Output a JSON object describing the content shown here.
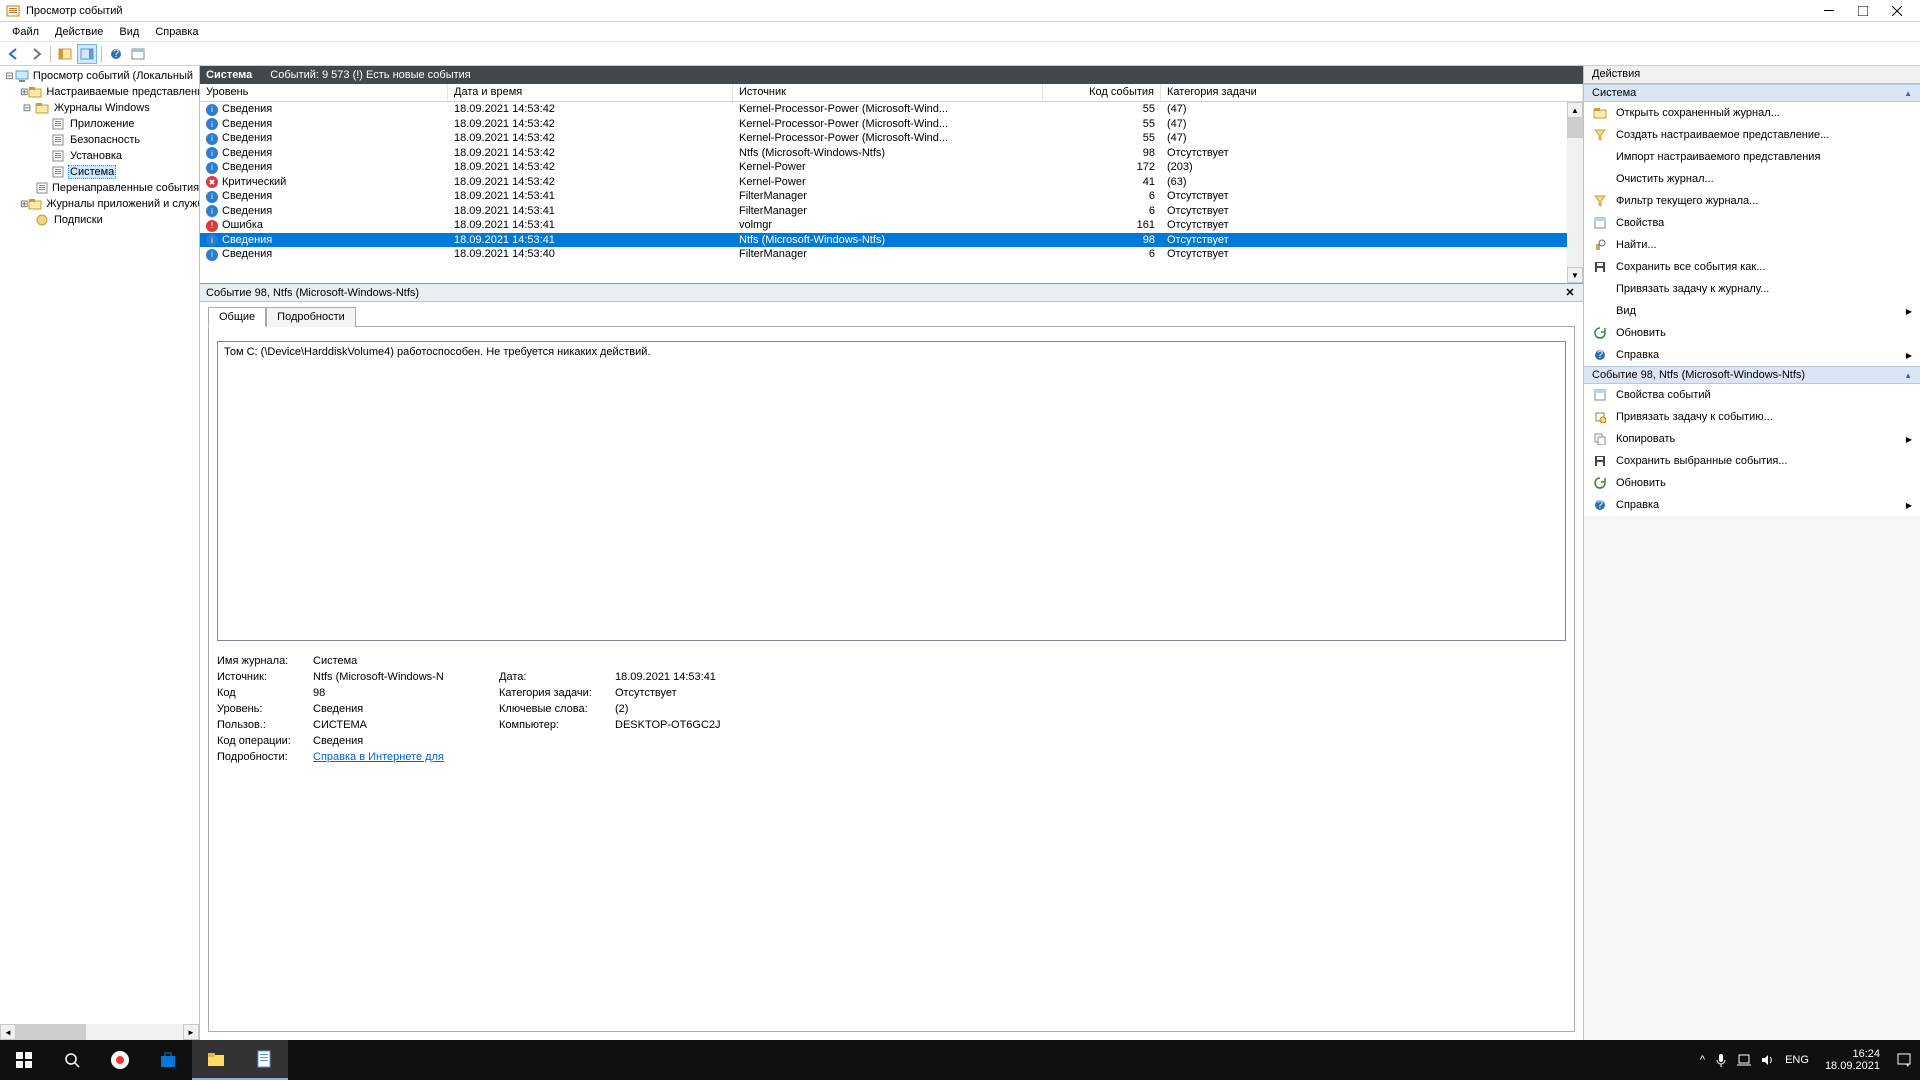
{
  "window": {
    "title": "Просмотр событий"
  },
  "menu": [
    "Файл",
    "Действие",
    "Вид",
    "Справка"
  ],
  "tree": [
    {
      "l": "Просмотр событий (Локальный",
      "d": 0,
      "exp": "-",
      "icon": "computer"
    },
    {
      "l": "Настраиваемые представления",
      "d": 1,
      "exp": ">",
      "icon": "folder"
    },
    {
      "l": "Журналы Windows",
      "d": 1,
      "exp": "-",
      "icon": "folder"
    },
    {
      "l": "Приложение",
      "d": 2,
      "exp": "",
      "icon": "log"
    },
    {
      "l": "Безопасность",
      "d": 2,
      "exp": "",
      "icon": "log"
    },
    {
      "l": "Установка",
      "d": 2,
      "exp": "",
      "icon": "log"
    },
    {
      "l": "Система",
      "d": 2,
      "exp": "",
      "icon": "log",
      "sel": true
    },
    {
      "l": "Перенаправленные события",
      "d": 2,
      "exp": "",
      "icon": "log"
    },
    {
      "l": "Журналы приложений и служб",
      "d": 1,
      "exp": ">",
      "icon": "folder"
    },
    {
      "l": "Подписки",
      "d": 1,
      "exp": "",
      "icon": "sub"
    }
  ],
  "center_header": {
    "group": "Система",
    "count": "Событий: 9 573 (!) Есть новые события"
  },
  "columns": [
    "Уровень",
    "Дата и время",
    "Источник",
    "Код события",
    "Категория задачи"
  ],
  "rows": [
    {
      "lvl": "Сведения",
      "ico": "info",
      "dt": "18.09.2021 14:53:42",
      "src": "Kernel-Processor-Power (Microsoft-Wind...",
      "code": "55",
      "cat": "(47)"
    },
    {
      "lvl": "Сведения",
      "ico": "info",
      "dt": "18.09.2021 14:53:42",
      "src": "Kernel-Processor-Power (Microsoft-Wind...",
      "code": "55",
      "cat": "(47)"
    },
    {
      "lvl": "Сведения",
      "ico": "info",
      "dt": "18.09.2021 14:53:42",
      "src": "Kernel-Processor-Power (Microsoft-Wind...",
      "code": "55",
      "cat": "(47)"
    },
    {
      "lvl": "Сведения",
      "ico": "info",
      "dt": "18.09.2021 14:53:42",
      "src": "Ntfs (Microsoft-Windows-Ntfs)",
      "code": "98",
      "cat": "Отсутствует"
    },
    {
      "lvl": "Сведения",
      "ico": "info",
      "dt": "18.09.2021 14:53:42",
      "src": "Kernel-Power",
      "code": "172",
      "cat": "(203)"
    },
    {
      "lvl": "Критический",
      "ico": "crit",
      "dt": "18.09.2021 14:53:42",
      "src": "Kernel-Power",
      "code": "41",
      "cat": "(63)"
    },
    {
      "lvl": "Сведения",
      "ico": "info",
      "dt": "18.09.2021 14:53:41",
      "src": "FilterManager",
      "code": "6",
      "cat": "Отсутствует"
    },
    {
      "lvl": "Сведения",
      "ico": "info",
      "dt": "18.09.2021 14:53:41",
      "src": "FilterManager",
      "code": "6",
      "cat": "Отсутствует"
    },
    {
      "lvl": "Ошибка",
      "ico": "err",
      "dt": "18.09.2021 14:53:41",
      "src": "volmgr",
      "code": "161",
      "cat": "Отсутствует"
    },
    {
      "lvl": "Сведения",
      "ico": "info",
      "dt": "18.09.2021 14:53:41",
      "src": "Ntfs (Microsoft-Windows-Ntfs)",
      "code": "98",
      "cat": "Отсутствует",
      "sel": true
    },
    {
      "lvl": "Сведения",
      "ico": "info",
      "dt": "18.09.2021 14:53:40",
      "src": "FilterManager",
      "code": "6",
      "cat": "Отсутствует"
    }
  ],
  "detail": {
    "title": "Событие 98, Ntfs (Microsoft-Windows-Ntfs)",
    "tabs": [
      "Общие",
      "Подробности"
    ],
    "message": "Том C: (\\Device\\HarddiskVolume4) работоспособен.  Не требуется никаких действий.",
    "kv": {
      "log_k": "Имя журнала:",
      "log_v": "Система",
      "src_k": "Источник:",
      "src_v": "Ntfs (Microsoft-Windows-N",
      "date_k": "Дата:",
      "date_v": "18.09.2021 14:53:41",
      "code_k": "Код",
      "code_v": "98",
      "taskcat_k": "Категория задачи:",
      "taskcat_v": "Отсутствует",
      "lvl_k": "Уровень:",
      "lvl_v": "Сведения",
      "kw_k": "Ключевые слова:",
      "kw_v": "(2)",
      "user_k": "Пользов.:",
      "user_v": "СИСТЕМА",
      "comp_k": "Компьютер:",
      "comp_v": "DESKTOP-OT6GC2J",
      "op_k": "Код операции:",
      "op_v": "Сведения",
      "det_k": "Подробности:",
      "det_link": "Справка в Интернете для "
    }
  },
  "actions": {
    "header": "Действия",
    "sec1": "Система",
    "items1": [
      {
        "l": "Открыть сохраненный журнал...",
        "i": "open",
        "c": "#d8a23a"
      },
      {
        "l": "Создать настраиваемое представление...",
        "i": "filter",
        "c": "#e0a800"
      },
      {
        "l": "Импорт настраиваемого представления",
        "i": "",
        "c": ""
      },
      {
        "l": "Очистить журнал...",
        "i": "",
        "c": ""
      },
      {
        "l": "Фильтр текущего журнала...",
        "i": "filter",
        "c": "#e0a800"
      },
      {
        "l": "Свойства",
        "i": "props",
        "c": "#888"
      },
      {
        "l": "Найти...",
        "i": "find",
        "c": "#c8a85a"
      },
      {
        "l": "Сохранить все события как...",
        "i": "save",
        "c": "#444"
      },
      {
        "l": "Привязать задачу к журналу...",
        "i": "",
        "c": ""
      },
      {
        "l": "Вид",
        "i": "",
        "chev": true
      },
      {
        "l": "Обновить",
        "i": "refresh",
        "c": "#2e8b2e"
      },
      {
        "l": "Справка",
        "i": "help",
        "c": "#2f6fb5",
        "chev": true
      }
    ],
    "sec2": "Событие 98, Ntfs (Microsoft-Windows-Ntfs)",
    "items2": [
      {
        "l": "Свойства событий",
        "i": "props",
        "c": "#888"
      },
      {
        "l": "Привязать задачу к событию...",
        "i": "task",
        "c": "#b08030"
      },
      {
        "l": "Копировать",
        "i": "copy",
        "c": "#888",
        "chev": true
      },
      {
        "l": "Сохранить выбранные события...",
        "i": "save",
        "c": "#444"
      },
      {
        "l": "Обновить",
        "i": "refresh",
        "c": "#2e8b2e"
      },
      {
        "l": "Справка",
        "i": "help",
        "c": "#2f6fb5",
        "chev": true
      }
    ]
  },
  "taskbar": {
    "lang": "ENG",
    "time": "16:24",
    "date": "18.09.2021"
  }
}
